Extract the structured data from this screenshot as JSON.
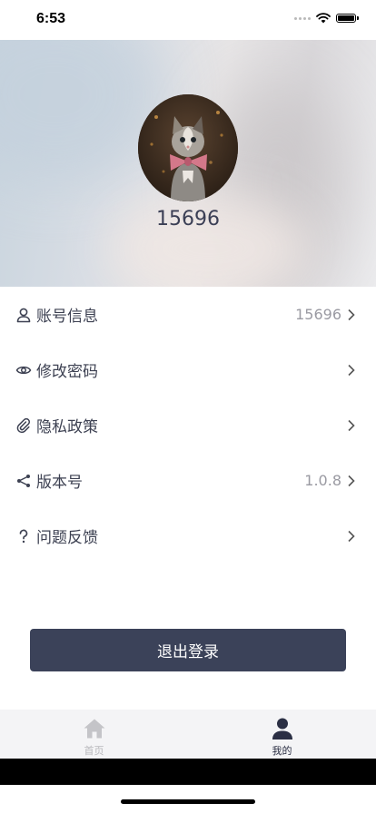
{
  "status": {
    "time": "6:53"
  },
  "profile": {
    "username": "15696"
  },
  "menu": [
    {
      "icon": "user-icon",
      "label": "账号信息",
      "value": "15696"
    },
    {
      "icon": "eye-icon",
      "label": "修改密码",
      "value": ""
    },
    {
      "icon": "paperclip-icon",
      "label": "隐私政策",
      "value": ""
    },
    {
      "icon": "share-icon",
      "label": "版本号",
      "value": "1.0.8"
    },
    {
      "icon": "question-icon",
      "label": "问题反馈",
      "value": ""
    }
  ],
  "logout_label": "退出登录",
  "tabbar": {
    "home_label": "首页",
    "mine_label": "我的",
    "active": "mine"
  },
  "colors": {
    "primary": "#3b4259",
    "text": "#3d4152",
    "muted": "#9a9aa2",
    "tab_inactive": "#b8b8bc"
  }
}
